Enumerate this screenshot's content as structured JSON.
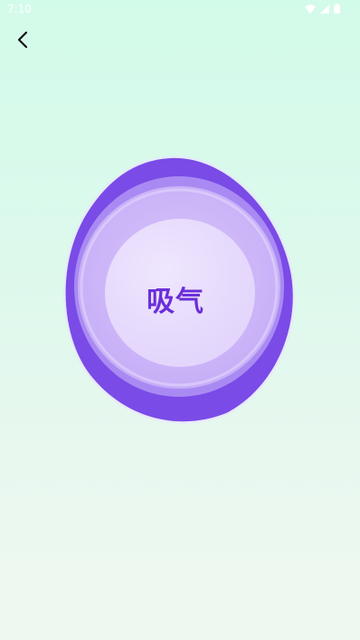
{
  "status_bar": {
    "time": "7:10",
    "icons": [
      "wifi-icon",
      "signal-icon",
      "battery-icon"
    ]
  },
  "header": {
    "back_icon": "chevron-left-icon"
  },
  "breathing": {
    "phase_label": "吸气"
  },
  "colors": {
    "background_top": "#d3fbea",
    "background_bottom": "#eef8f1",
    "outer_blob": "#7a4be6",
    "ring_mid": "#a98af3",
    "ring_inner": "#cdb8f9",
    "core": "#e8dcfd",
    "label": "#6b2fd9"
  }
}
